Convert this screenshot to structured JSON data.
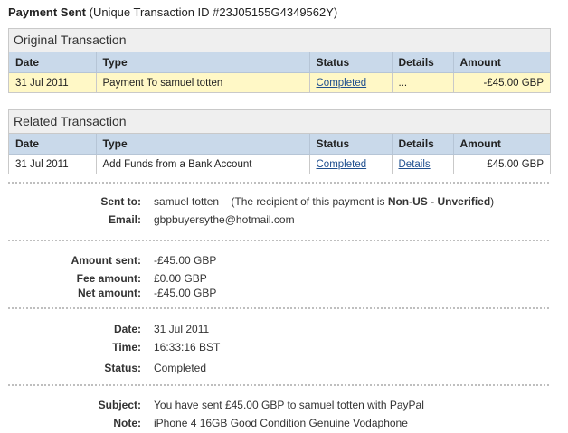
{
  "header": {
    "title": "Payment Sent",
    "subtitle": "(Unique Transaction ID #23J05155G4349562Y)"
  },
  "original": {
    "title": "Original Transaction",
    "columns": [
      "Date",
      "Type",
      "Status",
      "Details",
      "Amount"
    ],
    "row": {
      "date": "31 Jul 2011",
      "type": "Payment To samuel totten",
      "status": "Completed",
      "details": "...",
      "amount": "-£45.00 GBP"
    }
  },
  "related": {
    "title": "Related Transaction",
    "columns": [
      "Date",
      "Type",
      "Status",
      "Details",
      "Amount"
    ],
    "row": {
      "date": "31 Jul 2011",
      "type": "Add Funds from a Bank Account",
      "status": "Completed",
      "details": "Details",
      "amount": "£45.00 GBP"
    }
  },
  "recipient": {
    "sent_to_label": "Sent to:",
    "sent_to_name": "samuel totten",
    "note_prefix": "(The recipient of this payment is",
    "note_status": "Non-US - Unverified",
    "note_suffix": ")",
    "email_label": "Email:",
    "email": "gbpbuyersythe@hotmail.com"
  },
  "amounts": {
    "sent_label": "Amount sent:",
    "sent": "-£45.00 GBP",
    "fee_label": "Fee amount:",
    "fee": "£0.00 GBP",
    "net_label": "Net amount:",
    "net": "-£45.00 GBP"
  },
  "timing": {
    "date_label": "Date:",
    "date": "31 Jul 2011",
    "time_label": "Time:",
    "time": "16:33:16 BST",
    "status_label": "Status:",
    "status": "Completed"
  },
  "message": {
    "subject_label": "Subject:",
    "subject": "You have sent £45.00 GBP to samuel totten with PayPal",
    "note_label": "Note:",
    "note": "iPhone 4 16GB Good Condition Genuine Vodaphone"
  }
}
